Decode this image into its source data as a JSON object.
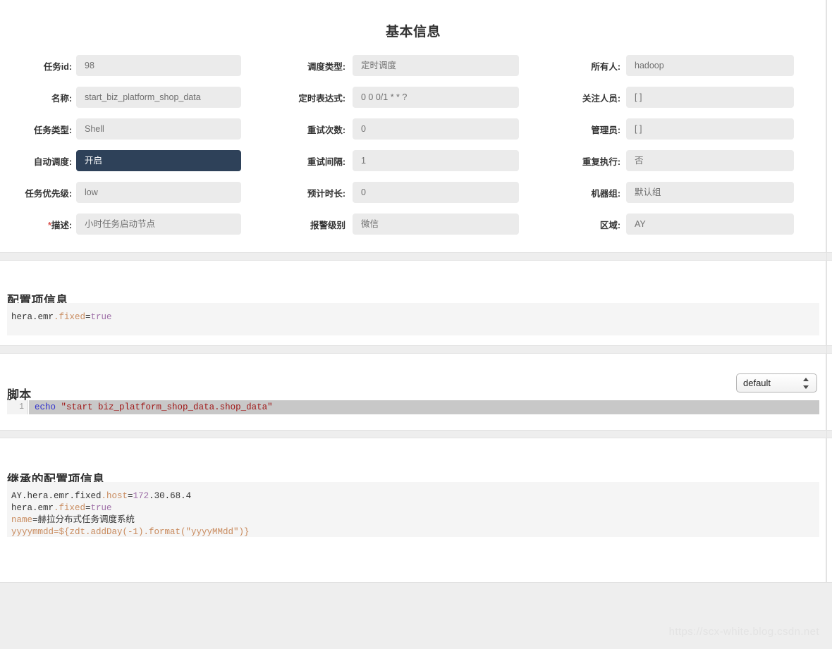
{
  "basic_info": {
    "title": "基本信息",
    "columns": [
      {
        "fields": [
          {
            "label": "任务id:",
            "value": "98",
            "highlighted": false,
            "required": false
          },
          {
            "label": "名称:",
            "value": "start_biz_platform_shop_data",
            "highlighted": false,
            "required": false
          },
          {
            "label": "任务类型:",
            "value": "Shell",
            "highlighted": false,
            "required": false
          },
          {
            "label": "自动调度:",
            "value": "开启",
            "highlighted": true,
            "required": false
          },
          {
            "label": "任务优先级:",
            "value": "low",
            "highlighted": false,
            "required": false
          },
          {
            "label": "描述:",
            "value": "小时任务启动节点",
            "highlighted": false,
            "required": true
          }
        ]
      },
      {
        "fields": [
          {
            "label": "调度类型:",
            "value": "定时调度",
            "highlighted": false,
            "required": false
          },
          {
            "label": "定时表达式:",
            "value": "0 0 0/1 * * ?",
            "highlighted": false,
            "required": false
          },
          {
            "label": "重试次数:",
            "value": "0",
            "highlighted": false,
            "required": false
          },
          {
            "label": "重试间隔:",
            "value": "1",
            "highlighted": false,
            "required": false
          },
          {
            "label": "预计时长:",
            "value": "0",
            "highlighted": false,
            "required": false
          },
          {
            "label": "报警级别",
            "value": "微信",
            "highlighted": false,
            "required": false
          }
        ]
      },
      {
        "fields": [
          {
            "label": "所有人:",
            "value": "hadoop",
            "highlighted": false,
            "required": false
          },
          {
            "label": "关注人员:",
            "value": "[ ]",
            "highlighted": false,
            "required": false
          },
          {
            "label": "管理员:",
            "value": "[ ]",
            "highlighted": false,
            "required": false
          },
          {
            "label": "重复执行:",
            "value": "否",
            "highlighted": false,
            "required": false
          },
          {
            "label": "机器组:",
            "value": "默认组",
            "highlighted": false,
            "required": false
          },
          {
            "label": "区域:",
            "value": "AY",
            "highlighted": false,
            "required": false
          }
        ]
      }
    ]
  },
  "config_info": {
    "title": "配置项信息",
    "lines": [
      {
        "tokens": [
          {
            "text": "hera.emr",
            "kind": "plain"
          },
          {
            "text": ".fixed",
            "kind": "prop"
          },
          {
            "text": "=",
            "kind": "plain"
          },
          {
            "text": "true",
            "kind": "value"
          }
        ]
      }
    ],
    "raw": "hera.emr.fixed=true"
  },
  "script": {
    "title": "脚本",
    "select": {
      "value": "default",
      "options": [
        "default"
      ]
    },
    "lines": [
      {
        "number": "1",
        "tokens": [
          {
            "text": "echo",
            "kind": "keyword"
          },
          {
            "text": " ",
            "kind": "plain"
          },
          {
            "text": "\"start biz_platform_shop_data.shop_data\"",
            "kind": "string"
          }
        ]
      }
    ],
    "raw": "echo \"start biz_platform_shop_data.shop_data\""
  },
  "inherited_config": {
    "title": "继承的配置项信息",
    "lines": [
      {
        "tokens": [
          {
            "text": "AY.hera.emr.fixed",
            "kind": "plain"
          },
          {
            "text": ".host",
            "kind": "prop"
          },
          {
            "text": "=",
            "kind": "plain"
          },
          {
            "text": "172",
            "kind": "value"
          },
          {
            "text": ".30.68.4",
            "kind": "plain"
          }
        ]
      },
      {
        "tokens": [
          {
            "text": "hera.emr",
            "kind": "plain"
          },
          {
            "text": ".fixed",
            "kind": "prop"
          },
          {
            "text": "=",
            "kind": "plain"
          },
          {
            "text": "true",
            "kind": "value"
          }
        ]
      },
      {
        "tokens": [
          {
            "text": "name",
            "kind": "prop"
          },
          {
            "text": "=赫拉分布式任务调度系统",
            "kind": "plain"
          }
        ]
      },
      {
        "tokens": [
          {
            "text": "yyyymmdd=${zdt.addDay(-1).format(\"yyyyMMdd\")}",
            "kind": "prop"
          }
        ]
      }
    ],
    "raw": "AY.hera.emr.fixed.host=172.30.68.4\nhera.emr.fixed=true\nname=赫拉分布式任务调度系统\nyyyymmdd=${zdt.addDay(-1).format(\"yyyyMMdd\")}"
  },
  "footer": {
    "watermark": "https://scx-white.blog.csdn.net"
  },
  "colors": {
    "accent_enabled": "#2e4159",
    "field_bg": "#ebebeb",
    "code_bg": "#f5f5f5",
    "token_prop": "#c98b5e",
    "token_value": "#9f70a8",
    "token_keyword": "#3333cc",
    "token_string": "#a01818",
    "required_mark": "#d9534f"
  }
}
